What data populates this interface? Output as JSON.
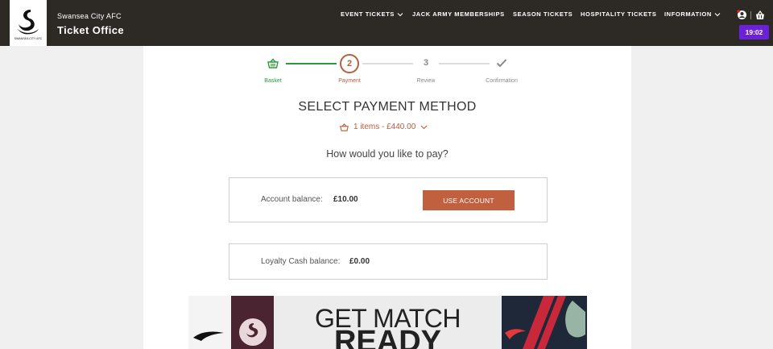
{
  "header": {
    "club_name": "Swansea City AFC",
    "app_title": "Ticket Office",
    "logo_text": "SWANSEA CITY AFC",
    "nav": [
      {
        "label": "EVENT TICKETS",
        "has_dropdown": true
      },
      {
        "label": "JACK ARMY MEMBERSHIPS",
        "has_dropdown": false
      },
      {
        "label": "SEASON TICKETS",
        "has_dropdown": false
      },
      {
        "label": "HOSPITALITY TICKETS",
        "has_dropdown": false
      },
      {
        "label": "INFORMATION",
        "has_dropdown": true
      }
    ],
    "account_icon": "user-icon",
    "basket_icon": "basket-icon",
    "timer": "19:02",
    "timer_color": "#6b21d9"
  },
  "stepper": {
    "steps": [
      {
        "label": "Basket",
        "state": "done",
        "icon": "basket-icon"
      },
      {
        "label": "Payment",
        "number": "2",
        "state": "active"
      },
      {
        "label": "Review",
        "number": "3",
        "state": "pending"
      },
      {
        "label": "Confirmation",
        "state": "pending",
        "icon": "check-icon"
      }
    ],
    "done_color": "#2e9a3e",
    "active_color": "#b85c3c"
  },
  "main": {
    "title": "SELECT PAYMENT METHOD",
    "basket_summary": "1 items - £440.00",
    "question": "How would you like to pay?",
    "account": {
      "label": "Account balance:",
      "value": "£10.00",
      "button": "USE ACCOUNT"
    },
    "loyalty": {
      "label": "Loyalty Cash balance:",
      "value": "£0.00"
    }
  },
  "banner": {
    "line1": "GET MATCH",
    "line2": "READY"
  },
  "colors": {
    "header_bg": "#2d2a26",
    "accent": "#c0603f"
  }
}
